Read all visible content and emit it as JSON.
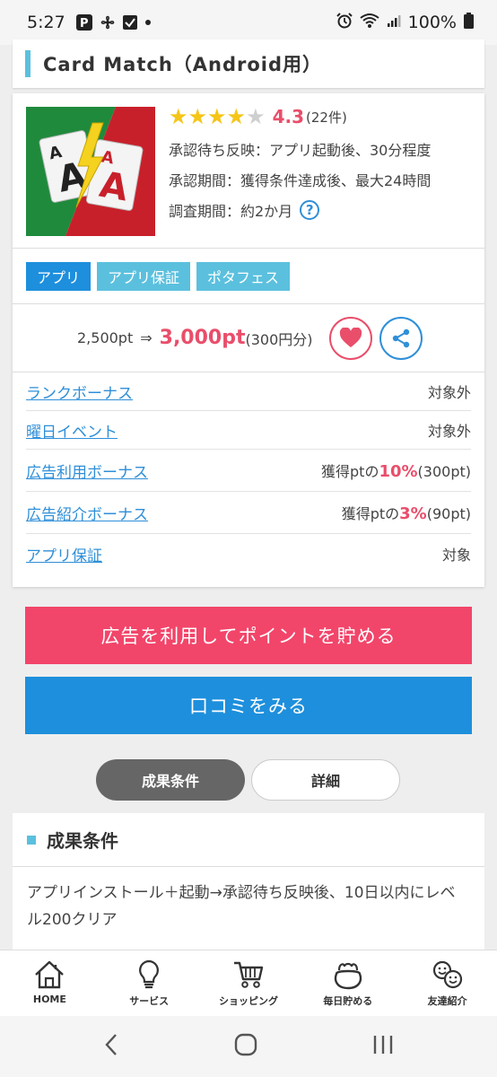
{
  "status_bar": {
    "time": "5:27",
    "battery": "100%"
  },
  "title": "Card Match（Android用）",
  "app": {
    "rating": "4.3",
    "rating_stars": 4,
    "rating_count": "(22件)",
    "info": [
      "承認待ち反映：アプリ起動後、30分程度",
      "承認期間：獲得条件達成後、最大24時間",
      "調査期間：約2か月"
    ]
  },
  "tags": [
    {
      "label": "アプリ",
      "color": "#1e8fdc"
    },
    {
      "label": "アプリ保証",
      "color": "#5bc0de"
    },
    {
      "label": "ポタフェス",
      "color": "#5bc0de"
    }
  ],
  "points": {
    "from": "2,500pt",
    "arrow": "⇒",
    "to": "3,000pt",
    "yen": "(300円分)"
  },
  "bonuses": [
    {
      "label": "ランクボーナス",
      "value": "対象外"
    },
    {
      "label": "曜日イベント",
      "value": "対象外"
    },
    {
      "label": "広告利用ボーナス",
      "prefix": "獲得ptの",
      "highlight": "10%",
      "suffix": "(300pt)"
    },
    {
      "label": "広告紹介ボーナス",
      "prefix": "獲得ptの",
      "highlight": "3%",
      "suffix": "(90pt)"
    },
    {
      "label": "アプリ保証",
      "value": "対象"
    }
  ],
  "buttons": {
    "earn": "広告を利用してポイントを貯める",
    "reviews": "口コミをみる"
  },
  "segments": {
    "active": "成果条件",
    "inactive": "詳細"
  },
  "condition": {
    "title": "成果条件",
    "body": "アプリインストール＋起動→承認待ち反映後、10日以内にレベル200クリア"
  },
  "bottom_nav": [
    {
      "label": "HOME",
      "icon": "home-icon"
    },
    {
      "label": "サービス",
      "icon": "lightbulb-icon"
    },
    {
      "label": "ショッピング",
      "icon": "cart-icon"
    },
    {
      "label": "毎日貯める",
      "icon": "purse-icon"
    },
    {
      "label": "友達紹介",
      "icon": "friends-icon"
    }
  ],
  "colors": {
    "accent_pink": "#e94e6a",
    "accent_blue": "#1e8fdc",
    "light_blue": "#5bc0de"
  }
}
